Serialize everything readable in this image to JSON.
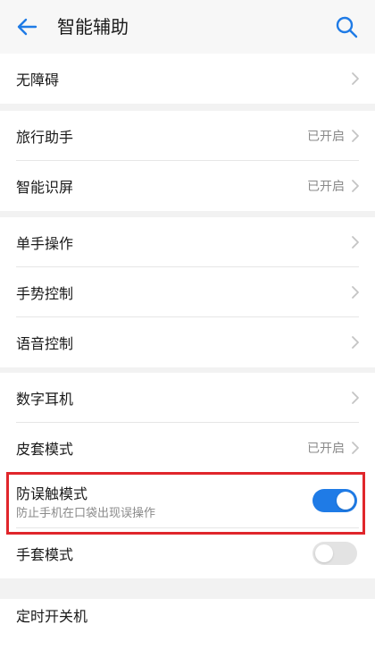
{
  "header": {
    "title": "智能辅助",
    "back_icon": "arrow-left-icon",
    "search_icon": "search-icon",
    "accent_color": "#1f7be6"
  },
  "group1": {
    "items": [
      {
        "label": "无障碍"
      }
    ]
  },
  "group2": {
    "items": [
      {
        "label": "旅行助手",
        "status": "已开启"
      },
      {
        "label": "智能识屏",
        "status": "已开启"
      }
    ]
  },
  "group3": {
    "items": [
      {
        "label": "单手操作"
      },
      {
        "label": "手势控制"
      },
      {
        "label": "语音控制"
      }
    ]
  },
  "group4": {
    "items": [
      {
        "label": "数字耳机"
      },
      {
        "label": "皮套模式",
        "status": "已开启"
      },
      {
        "label": "防误触模式",
        "sublabel": "防止手机在口袋出现误操作",
        "toggle": true
      },
      {
        "label": "手套模式",
        "toggle": false
      }
    ]
  },
  "group5": {
    "items": [
      {
        "label": "定时开关机"
      }
    ]
  },
  "highlight_color": "#e0262b"
}
